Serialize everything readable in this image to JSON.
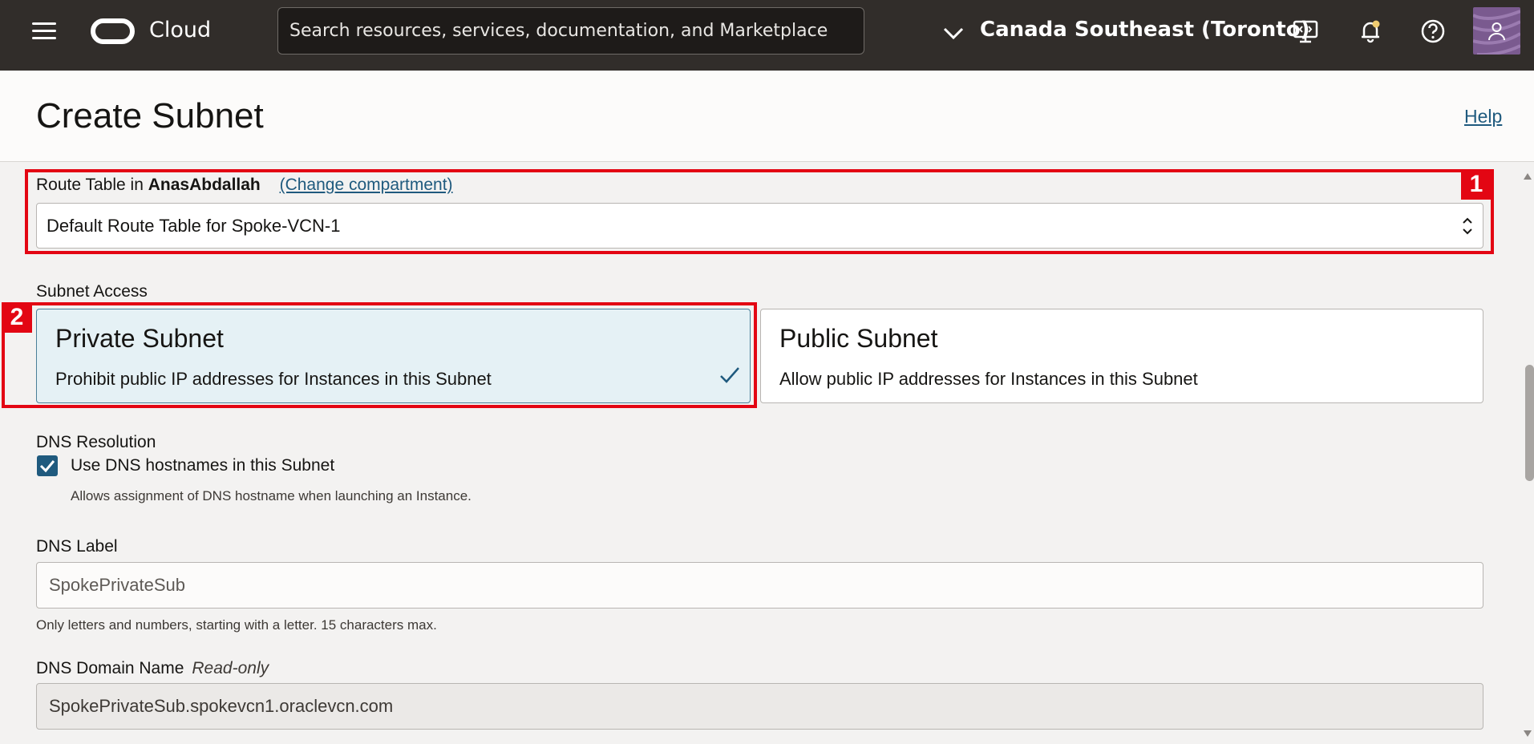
{
  "topbar": {
    "brand": "Cloud",
    "search_placeholder": "Search resources, services, documentation, and Marketplace",
    "region": "Canada Southeast (Toronto)"
  },
  "header": {
    "title": "Create Subnet",
    "help": "Help"
  },
  "route_table": {
    "label_prefix": "Route Table in",
    "compartment": "AnasAbdallah",
    "change_link": "(Change compartment)",
    "selected": "Default Route Table for Spoke-VCN-1"
  },
  "subnet_access": {
    "label": "Subnet Access",
    "private": {
      "title": "Private Subnet",
      "desc": "Prohibit public IP addresses for Instances in this Subnet"
    },
    "public": {
      "title": "Public Subnet",
      "desc": "Allow public IP addresses for Instances in this Subnet"
    }
  },
  "dns_resolution": {
    "label": "DNS Resolution",
    "checkbox_label": "Use DNS hostnames in this Subnet",
    "hint": "Allows assignment of DNS hostname when launching an Instance."
  },
  "dns_label": {
    "label": "DNS Label",
    "value": "SpokePrivateSub",
    "hint": "Only letters and numbers, starting with a letter. 15 characters max."
  },
  "dns_domain": {
    "label": "DNS Domain Name",
    "readonly": "Read-only",
    "value": "SpokePrivateSub.spokevcn1.oraclevcn.com"
  },
  "annotations": {
    "badge1": "1",
    "badge2": "2"
  },
  "colors": {
    "topbar": "#312d2a",
    "accent": "#1f5a7e",
    "annotation": "#e30613",
    "selected_card": "#e5f1f5"
  }
}
